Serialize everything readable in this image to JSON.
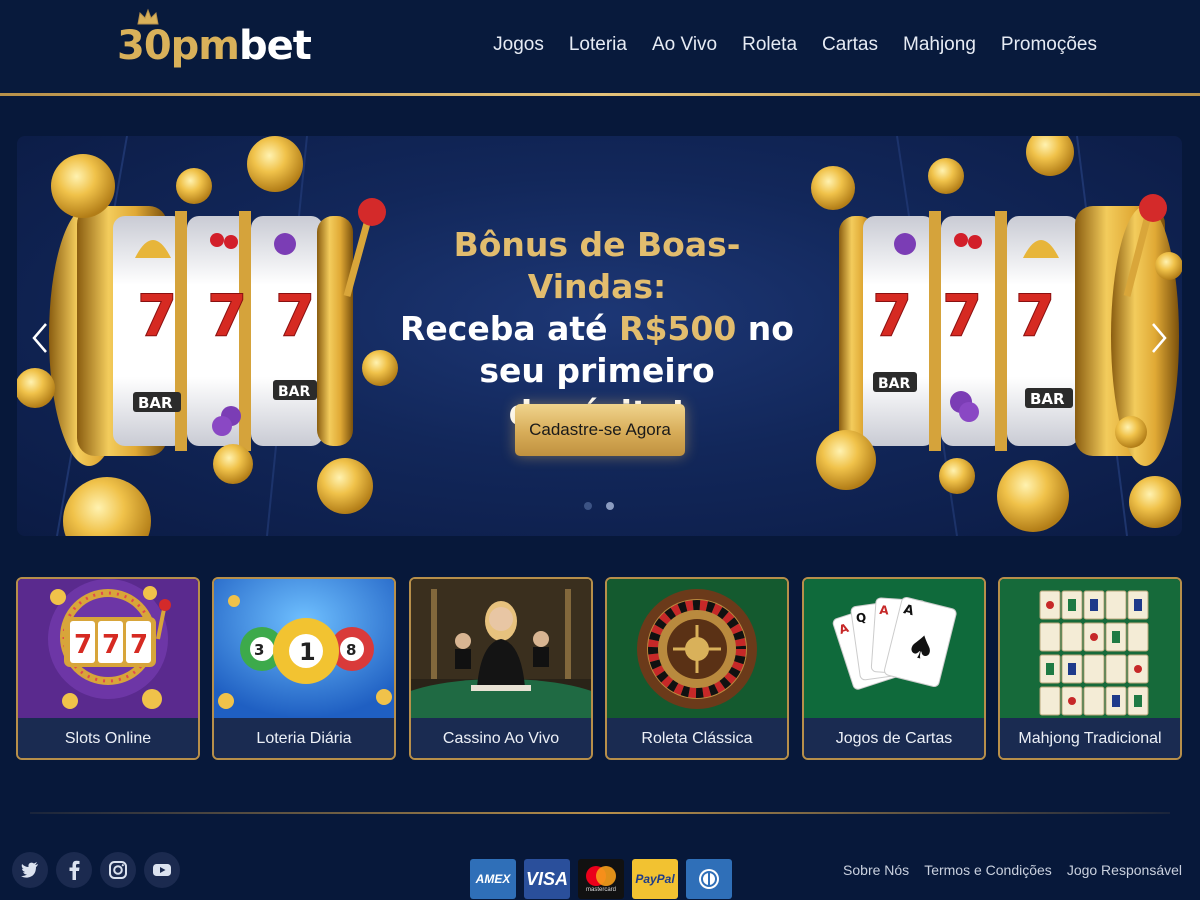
{
  "brand": {
    "logo_gold": "30pm",
    "logo_white": "bet"
  },
  "nav": {
    "items": [
      "Jogos",
      "Loteria",
      "Ao Vivo",
      "Roleta",
      "Cartas",
      "Mahjong",
      "Promoções"
    ]
  },
  "hero": {
    "line1": "Bônus de Boas-Vindas:",
    "line2_prefix": "Receba até ",
    "line2_amount": "R$500",
    "line2_suffix": " no",
    "line3": "seu primeiro depósito!",
    "cta_label": "Cadastre-se Agora",
    "slide_count": 2,
    "active_slide": 2
  },
  "categories": [
    {
      "label": "Slots Online"
    },
    {
      "label": "Loteria Diária"
    },
    {
      "label": "Cassino Ao Vivo"
    },
    {
      "label": "Roleta Clássica"
    },
    {
      "label": "Jogos de Cartas"
    },
    {
      "label": "Mahjong Tradicional"
    }
  ],
  "footer": {
    "social": [
      "twitter-icon",
      "facebook-icon",
      "instagram-icon",
      "youtube-icon"
    ],
    "payments": {
      "amex": "AMEX",
      "visa": "VISA",
      "mastercard": "mastercard",
      "paypal": "PayPal",
      "diners": "diners-club-icon"
    },
    "links": [
      "Sobre Nós",
      "Termos e Condições",
      "Jogo Responsável"
    ]
  },
  "colors": {
    "gold": "#d9b15a",
    "navy": "#07183a",
    "card_label_bg": "#1a2b51"
  }
}
